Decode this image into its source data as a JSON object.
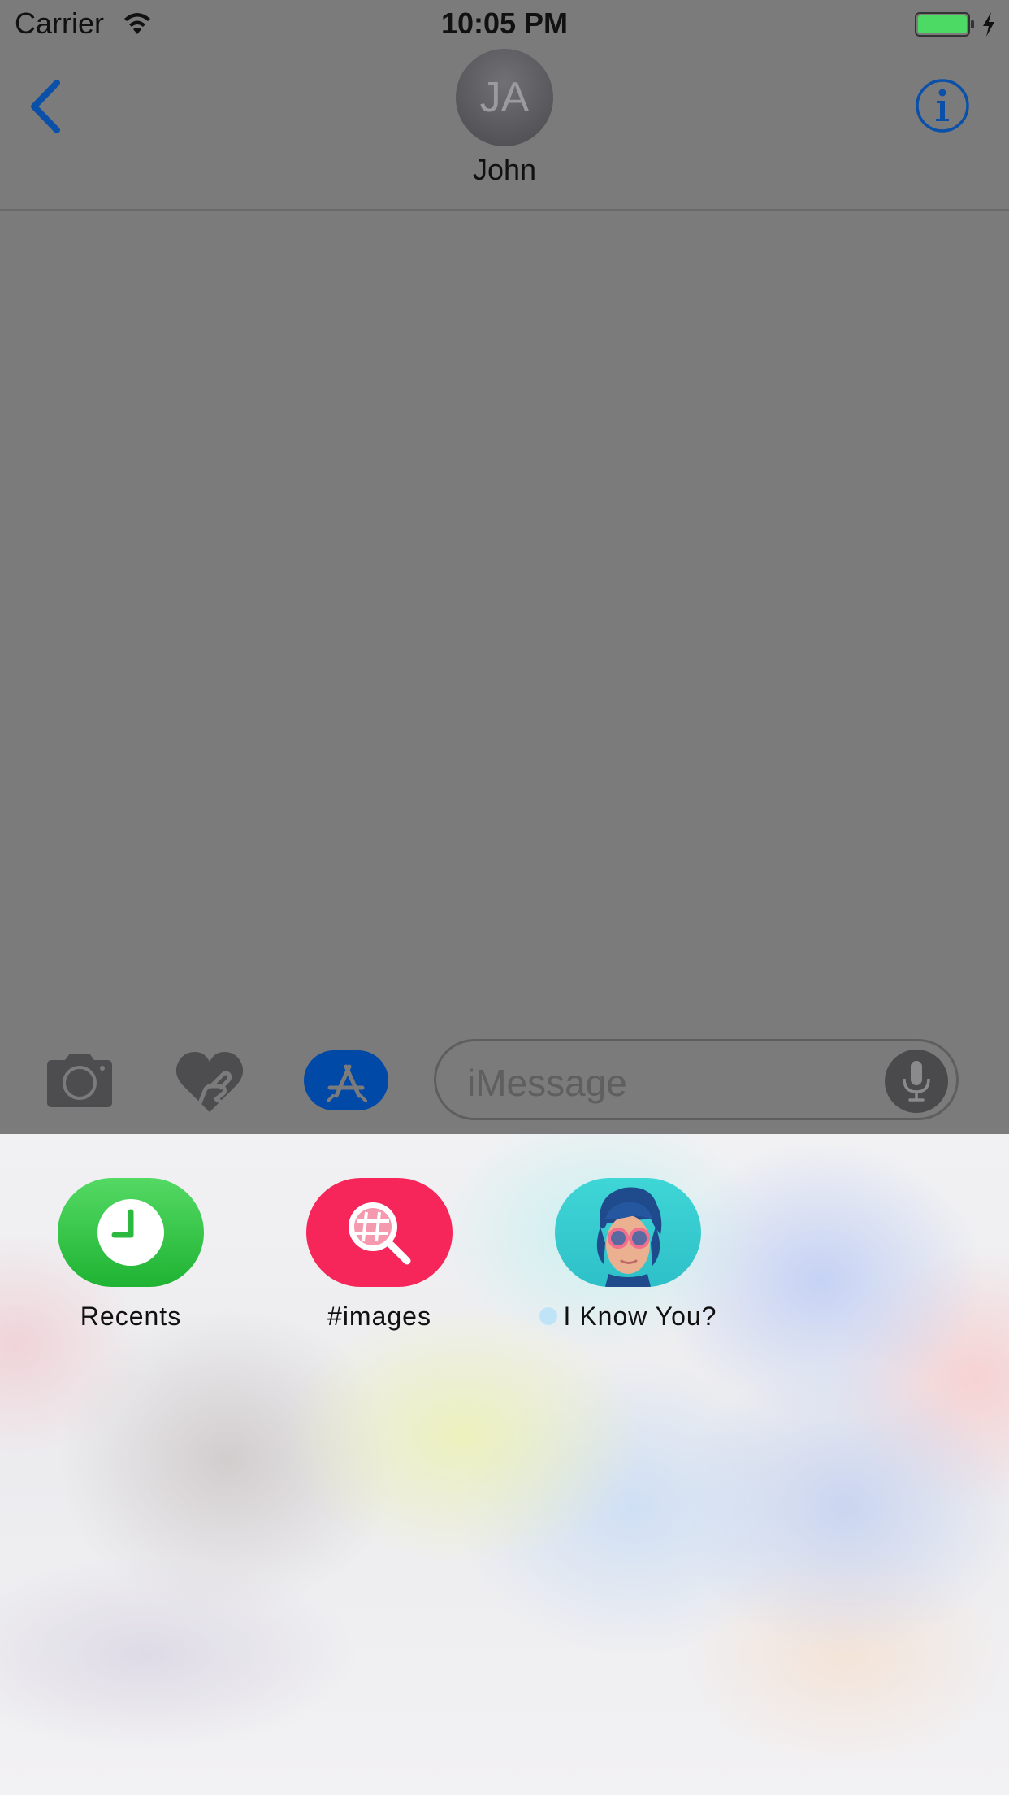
{
  "status_bar": {
    "carrier": "Carrier",
    "time": "10:05 PM",
    "battery_color": "#4cd964"
  },
  "nav": {
    "back_icon": "chevron-left-icon",
    "avatar_initials": "JA",
    "contact_name": "John",
    "info_icon": "info-icon",
    "accent_color": "#0b50a8"
  },
  "input_bar": {
    "camera_icon": "camera-icon",
    "digital_touch_icon": "heart-hand-icon",
    "appstore_icon": "app-store-icon",
    "message_placeholder": "iMessage",
    "mic_icon": "microphone-icon"
  },
  "app_drawer": {
    "apps": [
      {
        "label": "Recents",
        "icon": "clock-icon",
        "color": "#3bc24c"
      },
      {
        "label": "#images",
        "icon": "magnifier-hash-icon",
        "color": "#f6265a"
      },
      {
        "label": "I Know You?",
        "icon": "face-avatar-icon",
        "color": "#36cfd0",
        "new_indicator": true
      }
    ]
  }
}
